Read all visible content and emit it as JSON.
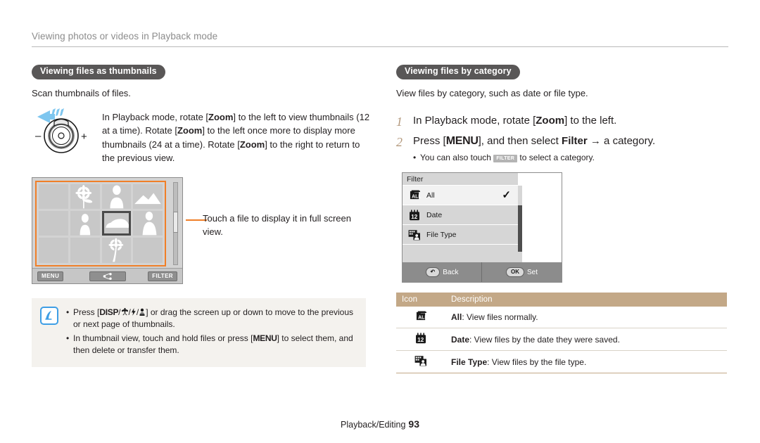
{
  "header": {
    "breadcrumb": "Viewing photos or videos in Playback mode"
  },
  "left": {
    "section_title": "Viewing files as thumbnails",
    "lead": "Scan thumbnails of files.",
    "figure_text_parts": {
      "p1": "In Playback mode, rotate [",
      "zoom1": "Zoom",
      "p2": "] to the left to view thumbnails (12 at a time). Rotate [",
      "zoom2": "Zoom",
      "p3": "] to the left once more to display more thumbnails (24 at a time). Rotate [",
      "zoom3": "Zoom",
      "p4": "] to the right to return to the previous view."
    },
    "lever": {
      "minus": "–",
      "plus": "+"
    },
    "screen": {
      "menu_button": "MENU",
      "filter_button": "FILTER",
      "share_icon": "share-icon",
      "thumbnails": [
        "blank",
        "flower",
        "person",
        "mountain",
        "blank",
        "person",
        "car",
        "person",
        "blank",
        "blank",
        "palm-tree",
        "blank"
      ],
      "selected_index": 6
    },
    "callout": "Touch a file to display it in full screen view.",
    "note": {
      "icon": "note-pencil-icon",
      "bullets": {
        "b1_p1": "Press [",
        "b1_disp": "DISP",
        "b1_sep1": "/",
        "b1_macro": "macro-icon",
        "b1_sep2": "/",
        "b1_flash": "flash-icon",
        "b1_sep3": "/",
        "b1_timer": "timer-icon",
        "b1_p2": "] or drag the screen up or down to move to the previous or next page of thumbnails.",
        "b2_p1": "In thumbnail view, touch and hold files or press [",
        "b2_menu": "MENU",
        "b2_p2": "] to select them, and then delete or transfer them."
      }
    }
  },
  "right": {
    "section_title": "Viewing files by category",
    "lead": "View files by category, such as date or file type.",
    "steps": [
      {
        "num": "1",
        "p1": "In Playback mode, rotate [",
        "b1": "Zoom",
        "p2": "] to the left."
      },
      {
        "num": "2",
        "p1": "Press [",
        "b1": "MENU",
        "p2": "], and then select ",
        "b2": "Filter",
        "p3": " → a category.",
        "sub_p1": "You can also touch ",
        "sub_chip": "FILTER",
        "sub_p2": " to select a category."
      }
    ],
    "dialog": {
      "title": "Filter",
      "rows": [
        {
          "icon": "all-files-icon",
          "label": "All",
          "checked": "✓"
        },
        {
          "icon": "date-calendar-icon",
          "label": "Date",
          "checked": ""
        },
        {
          "icon": "file-type-icon",
          "label": "File Type",
          "checked": ""
        }
      ],
      "back_key": "↶",
      "back_label": "Back",
      "ok_key": "OK",
      "ok_label": "Set"
    },
    "table": {
      "headers": [
        "Icon",
        "Description"
      ],
      "rows": [
        {
          "icon": "all-files-icon",
          "term": "All",
          "desc": ": View files normally."
        },
        {
          "icon": "date-calendar-icon",
          "term": "Date",
          "desc": ": View files by the date they were saved."
        },
        {
          "icon": "file-type-icon",
          "term": "File Type",
          "desc": ": View files by the file type."
        }
      ]
    }
  },
  "footer": {
    "chapter": "Playback/Editing",
    "page": "93"
  },
  "colors": {
    "accent_orange": "#f07f28",
    "badge_gray": "#595757",
    "table_header_tan": "#c3a887",
    "step_number_tan": "#b49a7e",
    "note_blue": "#3e9ee5"
  }
}
